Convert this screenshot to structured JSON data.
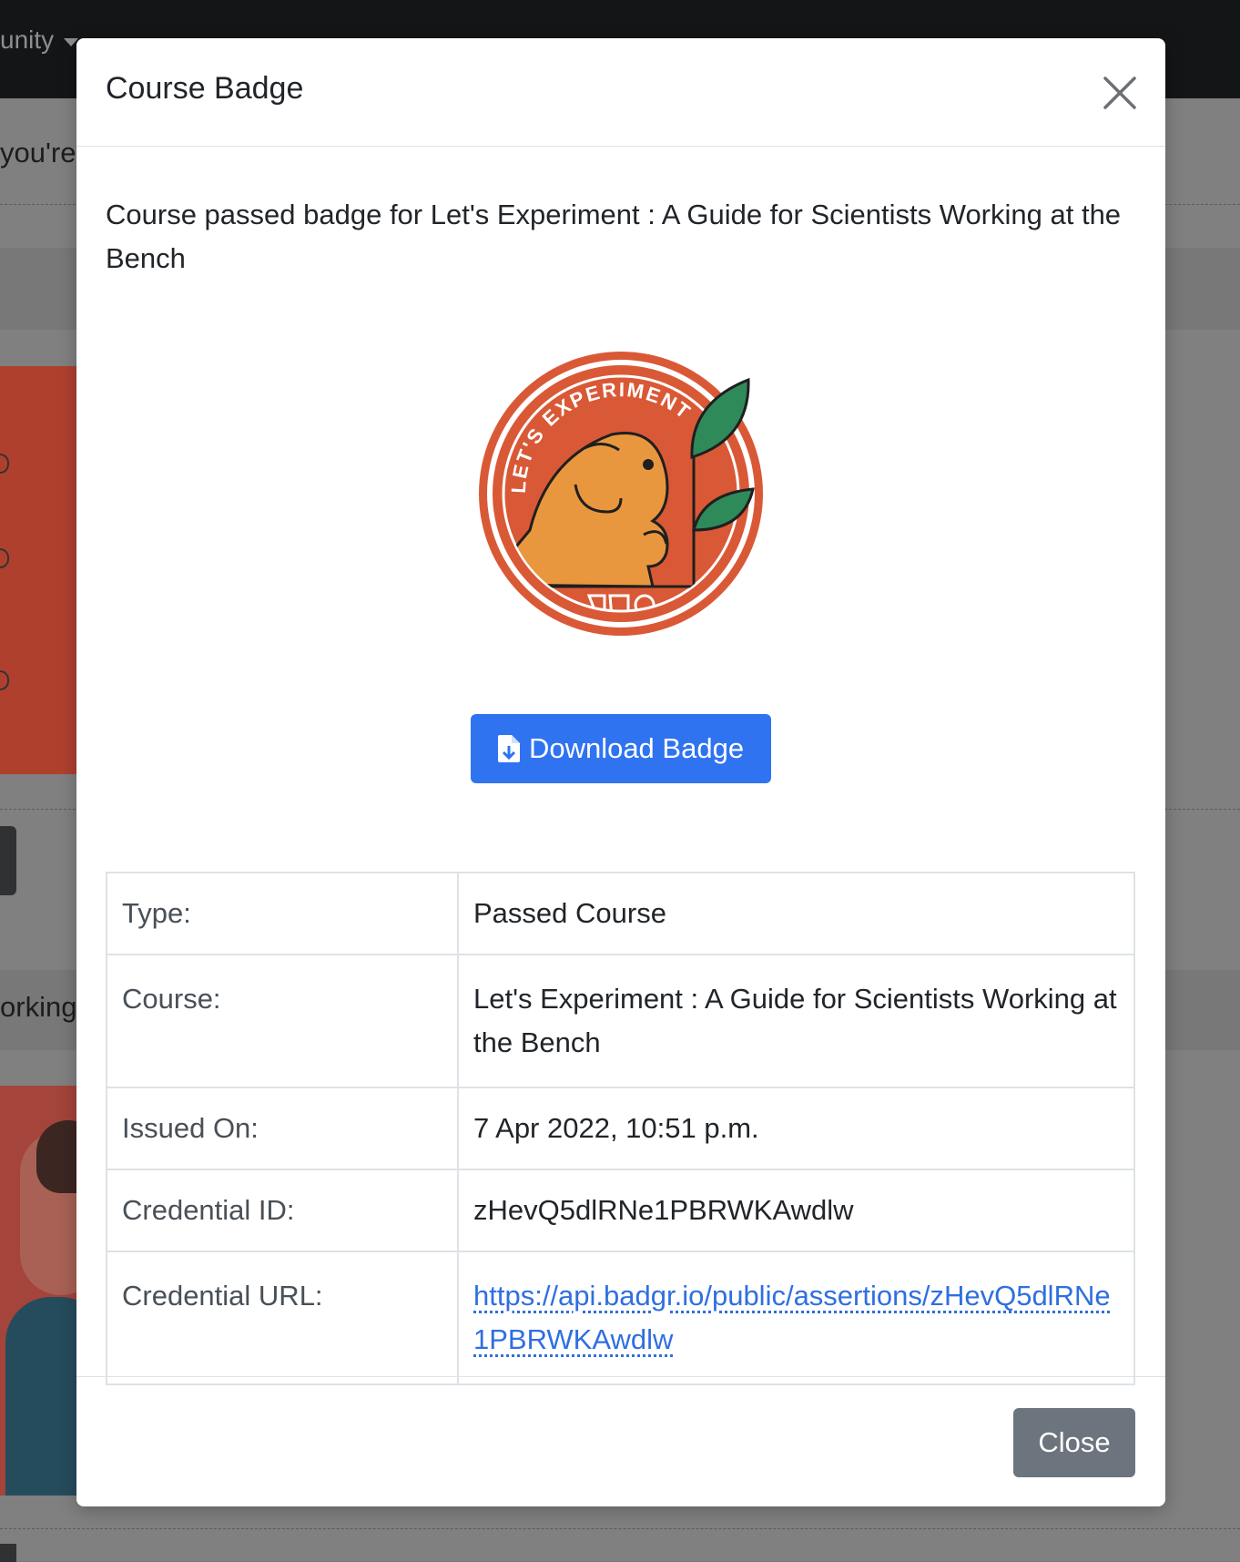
{
  "background": {
    "nav_text": "unity",
    "text_1": "you're",
    "text_2": "orking"
  },
  "modal": {
    "title": "Course Badge",
    "description": "Course passed badge for Let's Experiment : A Guide for Scientists Working at the Bench",
    "badge": {
      "arc_text": "LET'S EXPERIMENT",
      "colors": {
        "ring": "#d95936",
        "inner": "#d95936",
        "mascot": "#e9973e",
        "leaf": "#2f8a5a",
        "outline": "#1f1f1f"
      }
    },
    "download_label": "Download Badge",
    "details": [
      {
        "key": "Type:",
        "value": "Passed Course"
      },
      {
        "key": "Course:",
        "value": "Let's Experiment : A Guide for Scientists Working at the Bench"
      },
      {
        "key": "Issued On:",
        "value": "7 Apr 2022, 10:51 p.m."
      },
      {
        "key": "Credential ID:",
        "value": "zHevQ5dlRNe1PBRWKAwdlw"
      },
      {
        "key": "Credential URL:",
        "value": "https://api.badgr.io/public/assertions/zHevQ5dlRNe1PBRWKAwdlw"
      }
    ],
    "close_label": "Close"
  },
  "colors": {
    "primary": "#2f73f1",
    "secondary": "#6c757d",
    "link": "#2f6fe0",
    "backdrop": "#808080"
  }
}
